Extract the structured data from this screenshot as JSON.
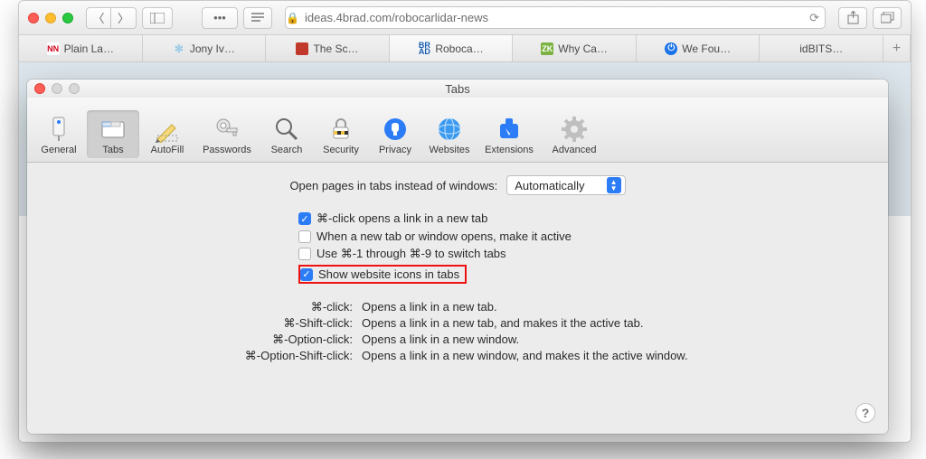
{
  "safari": {
    "url_display": "ideas.4brad.com/robocarlidar-news",
    "tabs": [
      {
        "label": "Plain La…",
        "icon": "nn",
        "icon_text": "NN"
      },
      {
        "label": "Jony Iv…",
        "icon": "jony",
        "icon_text": "✻"
      },
      {
        "label": "The Sc…",
        "icon": "science",
        "icon_text": ""
      },
      {
        "label": "Roboca…",
        "icon": "brad",
        "icon_text": "BR\nAD",
        "active": true
      },
      {
        "label": "Why Ca…",
        "icon": "zk",
        "icon_text": "ZK"
      },
      {
        "label": "We Fou…",
        "icon": "wefou",
        "icon_text": "⏻"
      },
      {
        "label": "idBITS…",
        "icon": "none",
        "icon_text": ""
      }
    ]
  },
  "prefs": {
    "title": "Tabs",
    "toolbar": [
      "General",
      "Tabs",
      "AutoFill",
      "Passwords",
      "Search",
      "Security",
      "Privacy",
      "Websites",
      "Extensions",
      "Advanced"
    ],
    "open_label": "Open pages in tabs instead of windows:",
    "open_value": "Automatically",
    "checks": {
      "c1": "⌘-click opens a link in a new tab",
      "c2": "When a new tab or window opens, make it active",
      "c3": "Use ⌘-1 through ⌘-9 to switch tabs",
      "c4": "Show website icons in tabs"
    },
    "shortcuts": {
      "k1": "⌘-click:",
      "v1": "Opens a link in a new tab.",
      "k2": "⌘-Shift-click:",
      "v2": "Opens a link in a new tab, and makes it the active tab.",
      "k3": "⌘-Option-click:",
      "v3": "Opens a link in a new window.",
      "k4": "⌘-Option-Shift-click:",
      "v4": "Opens a link in a new window, and makes it the active window."
    }
  }
}
